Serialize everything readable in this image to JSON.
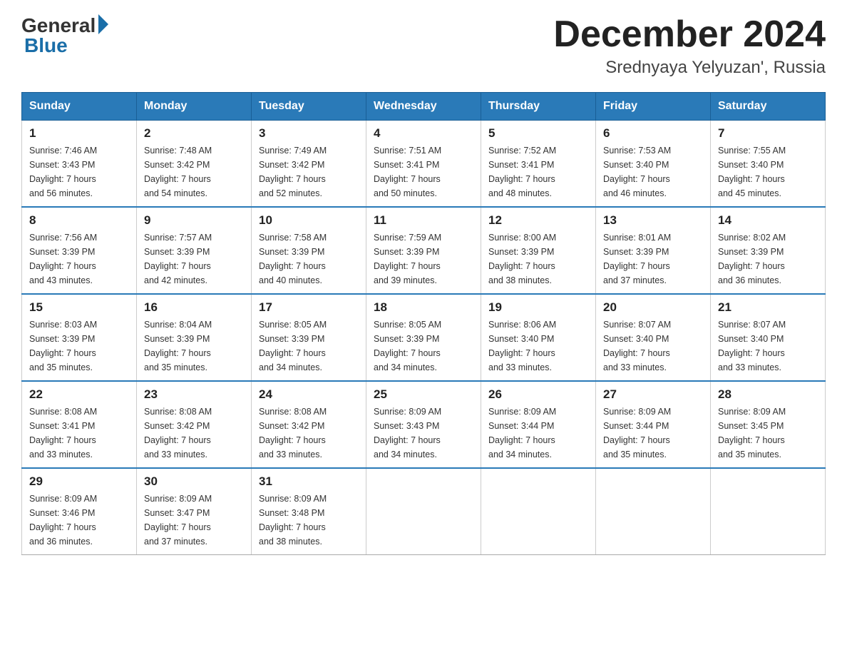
{
  "header": {
    "logo_general": "General",
    "logo_blue": "Blue",
    "month_title": "December 2024",
    "location": "Srednyaya Yelyuzan', Russia"
  },
  "days_of_week": [
    "Sunday",
    "Monday",
    "Tuesday",
    "Wednesday",
    "Thursday",
    "Friday",
    "Saturday"
  ],
  "weeks": [
    [
      {
        "day": "1",
        "sunrise": "7:46 AM",
        "sunset": "3:43 PM",
        "daylight": "7 hours and 56 minutes."
      },
      {
        "day": "2",
        "sunrise": "7:48 AM",
        "sunset": "3:42 PM",
        "daylight": "7 hours and 54 minutes."
      },
      {
        "day": "3",
        "sunrise": "7:49 AM",
        "sunset": "3:42 PM",
        "daylight": "7 hours and 52 minutes."
      },
      {
        "day": "4",
        "sunrise": "7:51 AM",
        "sunset": "3:41 PM",
        "daylight": "7 hours and 50 minutes."
      },
      {
        "day": "5",
        "sunrise": "7:52 AM",
        "sunset": "3:41 PM",
        "daylight": "7 hours and 48 minutes."
      },
      {
        "day": "6",
        "sunrise": "7:53 AM",
        "sunset": "3:40 PM",
        "daylight": "7 hours and 46 minutes."
      },
      {
        "day": "7",
        "sunrise": "7:55 AM",
        "sunset": "3:40 PM",
        "daylight": "7 hours and 45 minutes."
      }
    ],
    [
      {
        "day": "8",
        "sunrise": "7:56 AM",
        "sunset": "3:39 PM",
        "daylight": "7 hours and 43 minutes."
      },
      {
        "day": "9",
        "sunrise": "7:57 AM",
        "sunset": "3:39 PM",
        "daylight": "7 hours and 42 minutes."
      },
      {
        "day": "10",
        "sunrise": "7:58 AM",
        "sunset": "3:39 PM",
        "daylight": "7 hours and 40 minutes."
      },
      {
        "day": "11",
        "sunrise": "7:59 AM",
        "sunset": "3:39 PM",
        "daylight": "7 hours and 39 minutes."
      },
      {
        "day": "12",
        "sunrise": "8:00 AM",
        "sunset": "3:39 PM",
        "daylight": "7 hours and 38 minutes."
      },
      {
        "day": "13",
        "sunrise": "8:01 AM",
        "sunset": "3:39 PM",
        "daylight": "7 hours and 37 minutes."
      },
      {
        "day": "14",
        "sunrise": "8:02 AM",
        "sunset": "3:39 PM",
        "daylight": "7 hours and 36 minutes."
      }
    ],
    [
      {
        "day": "15",
        "sunrise": "8:03 AM",
        "sunset": "3:39 PM",
        "daylight": "7 hours and 35 minutes."
      },
      {
        "day": "16",
        "sunrise": "8:04 AM",
        "sunset": "3:39 PM",
        "daylight": "7 hours and 35 minutes."
      },
      {
        "day": "17",
        "sunrise": "8:05 AM",
        "sunset": "3:39 PM",
        "daylight": "7 hours and 34 minutes."
      },
      {
        "day": "18",
        "sunrise": "8:05 AM",
        "sunset": "3:39 PM",
        "daylight": "7 hours and 34 minutes."
      },
      {
        "day": "19",
        "sunrise": "8:06 AM",
        "sunset": "3:40 PM",
        "daylight": "7 hours and 33 minutes."
      },
      {
        "day": "20",
        "sunrise": "8:07 AM",
        "sunset": "3:40 PM",
        "daylight": "7 hours and 33 minutes."
      },
      {
        "day": "21",
        "sunrise": "8:07 AM",
        "sunset": "3:40 PM",
        "daylight": "7 hours and 33 minutes."
      }
    ],
    [
      {
        "day": "22",
        "sunrise": "8:08 AM",
        "sunset": "3:41 PM",
        "daylight": "7 hours and 33 minutes."
      },
      {
        "day": "23",
        "sunrise": "8:08 AM",
        "sunset": "3:42 PM",
        "daylight": "7 hours and 33 minutes."
      },
      {
        "day": "24",
        "sunrise": "8:08 AM",
        "sunset": "3:42 PM",
        "daylight": "7 hours and 33 minutes."
      },
      {
        "day": "25",
        "sunrise": "8:09 AM",
        "sunset": "3:43 PM",
        "daylight": "7 hours and 34 minutes."
      },
      {
        "day": "26",
        "sunrise": "8:09 AM",
        "sunset": "3:44 PM",
        "daylight": "7 hours and 34 minutes."
      },
      {
        "day": "27",
        "sunrise": "8:09 AM",
        "sunset": "3:44 PM",
        "daylight": "7 hours and 35 minutes."
      },
      {
        "day": "28",
        "sunrise": "8:09 AM",
        "sunset": "3:45 PM",
        "daylight": "7 hours and 35 minutes."
      }
    ],
    [
      {
        "day": "29",
        "sunrise": "8:09 AM",
        "sunset": "3:46 PM",
        "daylight": "7 hours and 36 minutes."
      },
      {
        "day": "30",
        "sunrise": "8:09 AM",
        "sunset": "3:47 PM",
        "daylight": "7 hours and 37 minutes."
      },
      {
        "day": "31",
        "sunrise": "8:09 AM",
        "sunset": "3:48 PM",
        "daylight": "7 hours and 38 minutes."
      },
      null,
      null,
      null,
      null
    ]
  ],
  "labels": {
    "sunrise": "Sunrise:",
    "sunset": "Sunset:",
    "daylight": "Daylight:"
  }
}
